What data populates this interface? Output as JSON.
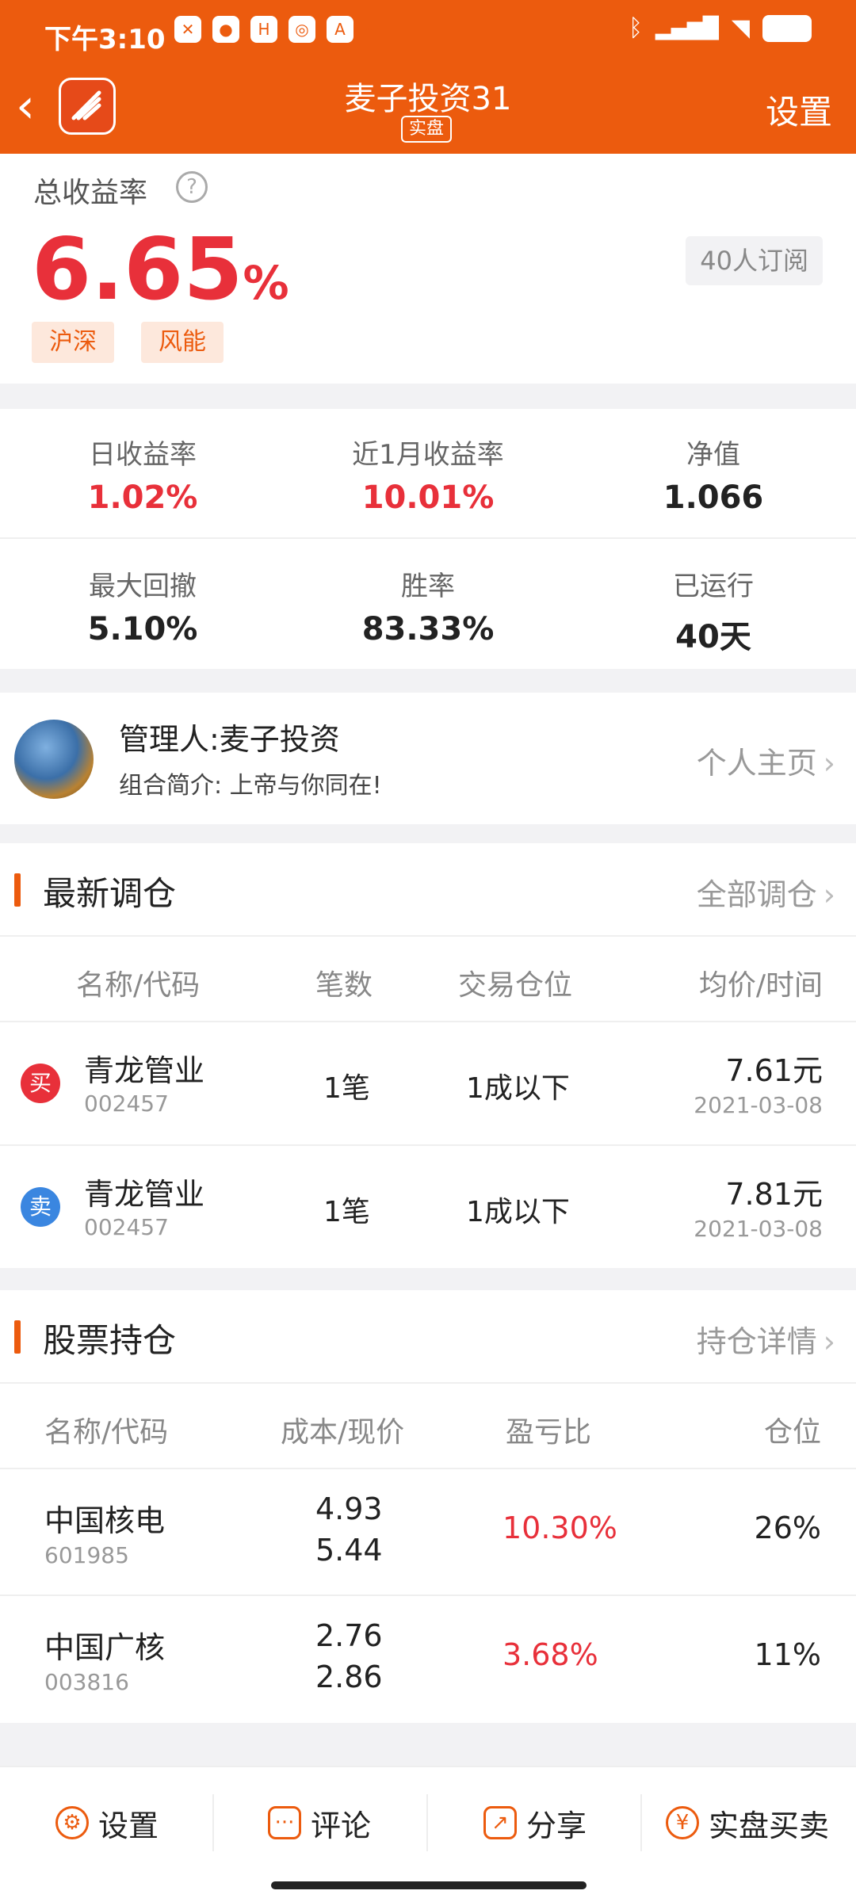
{
  "status_bar": {
    "time": "下午3:10",
    "dots": "···"
  },
  "nav": {
    "title": "麦子投资31",
    "tag": "实盘",
    "settings": "设置"
  },
  "hero": {
    "label": "总收益率",
    "help": "?",
    "value": "6.65",
    "unit": "%",
    "subscribers": "40人订阅",
    "tags": [
      "沪深",
      "风能"
    ]
  },
  "stats": [
    {
      "label": "日收益率",
      "value": "1.02%",
      "color": "#e8303a"
    },
    {
      "label": "近1月收益率",
      "value": "10.01%",
      "color": "#e8303a"
    },
    {
      "label": "净值",
      "value": "1.066",
      "color": "#222222"
    },
    {
      "label": "最大回撤",
      "value": "5.10%",
      "color": "#222222"
    },
    {
      "label": "胜率",
      "value": "83.33%",
      "color": "#222222"
    },
    {
      "label": "已运行",
      "value": "40天",
      "color": "#222222"
    }
  ],
  "manager": {
    "name": "管理人:麦子投资",
    "desc": "组合简介: 上帝与你同在!",
    "homepage": "个人主页",
    "chevron": "›"
  },
  "trades": {
    "title": "最新调仓",
    "more": "全部调仓",
    "headers": [
      "名称/代码",
      "笔数",
      "交易仓位",
      "均价/时间"
    ],
    "rows": [
      {
        "badge": "买",
        "badge_color": "#e8303a",
        "name": "青龙管业",
        "code": "002457",
        "count": "1笔",
        "position": "1成以下",
        "price": "7.61元",
        "date": "2021-03-08"
      },
      {
        "badge": "卖",
        "badge_color": "#3a86e0",
        "name": "青龙管业",
        "code": "002457",
        "count": "1笔",
        "position": "1成以下",
        "price": "7.81元",
        "date": "2021-03-08"
      }
    ]
  },
  "holdings": {
    "title": "股票持仓",
    "more": "持仓详情",
    "headers": [
      "名称/代码",
      "成本/现价",
      "盈亏比",
      "仓位"
    ],
    "rows": [
      {
        "name": "中国核电",
        "code": "601985",
        "cost": "4.93",
        "current": "5.44",
        "pl": "10.30%",
        "weight": "26%"
      },
      {
        "name": "中国广核",
        "code": "003816",
        "cost": "2.76",
        "current": "2.86",
        "pl": "3.68%",
        "weight": "11%"
      }
    ]
  },
  "bottom": [
    {
      "label": "设置",
      "icon": "gear-icon",
      "glyph": "⚙"
    },
    {
      "label": "评论",
      "icon": "comment-icon",
      "glyph": "···"
    },
    {
      "label": "分享",
      "icon": "share-icon",
      "glyph": "↗"
    },
    {
      "label": "实盘买卖",
      "icon": "yuan-icon",
      "glyph": "¥"
    }
  ],
  "colors": {
    "brand": "#ec5b0e",
    "up": "#e8303a",
    "sell": "#3a86e0"
  }
}
